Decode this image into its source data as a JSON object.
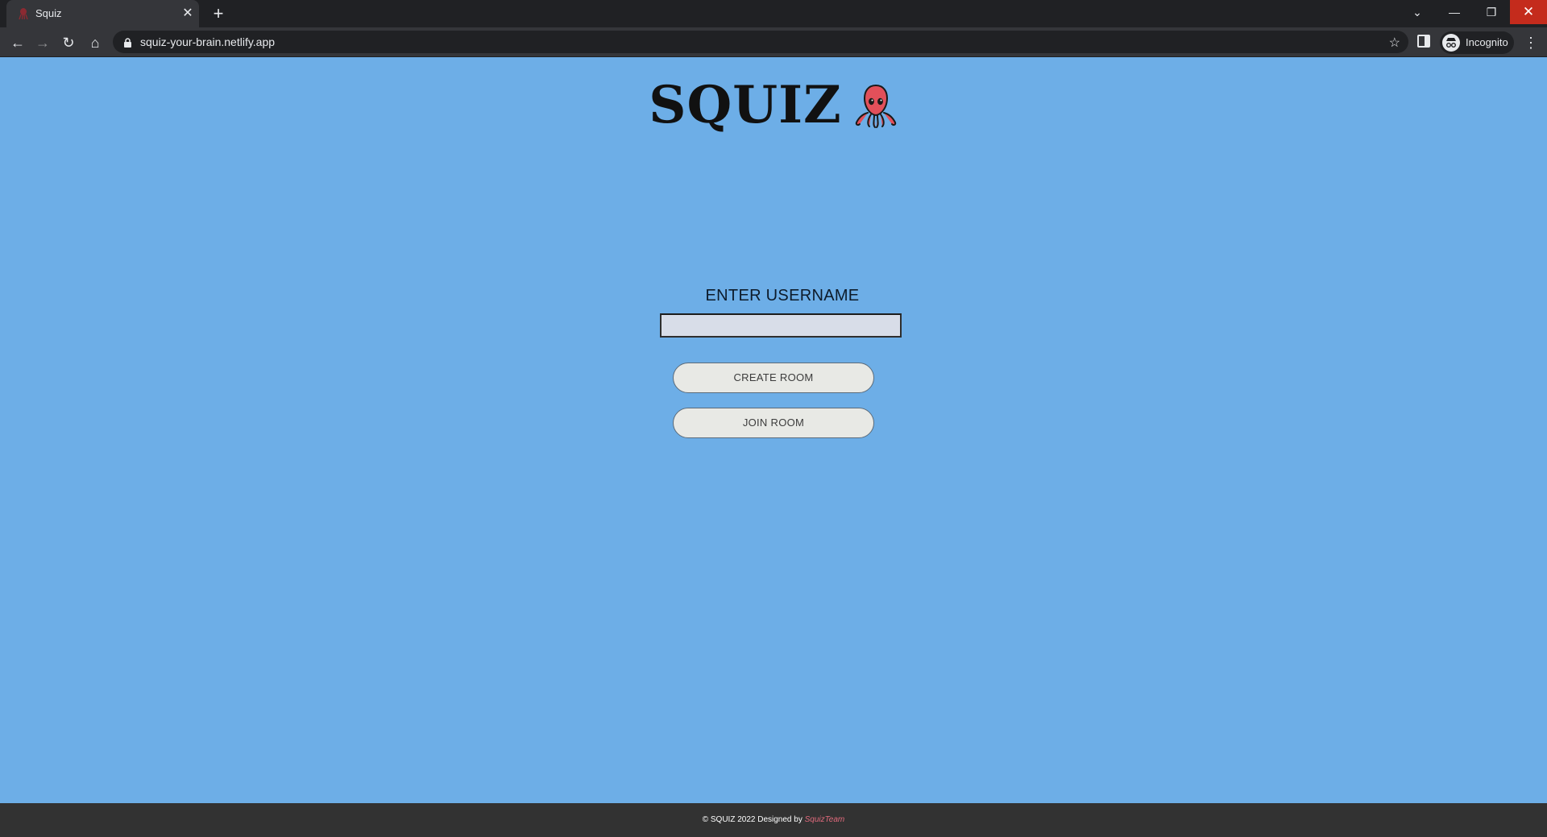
{
  "browser": {
    "tab_title": "Squiz",
    "tab_close": "✕",
    "new_tab": "+",
    "url": "squiz-your-brain.netlify.app",
    "profile_label": "Incognito",
    "window_controls": {
      "search_tabs": "⌄",
      "minimize": "—",
      "restore": "❐",
      "close": "✕"
    },
    "nav": {
      "back": "←",
      "forward": "→",
      "reload": "↻",
      "home": "⌂",
      "star": "☆",
      "menu": "⋮"
    }
  },
  "page": {
    "logo_text": "SQUIZ",
    "logo_icon": "octopus-icon",
    "username_label": "ENTER USERNAME",
    "username_value": "",
    "create_room_label": "CREATE ROOM",
    "join_room_label": "JOIN ROOM"
  },
  "footer": {
    "copyright": "© SQUIZ 2022 Designed by ",
    "team": "SquizTeam"
  },
  "colors": {
    "background": "#6daee7",
    "footer_bg": "#323232",
    "team_link": "#e06a7c",
    "octopus": "#e2505a"
  }
}
